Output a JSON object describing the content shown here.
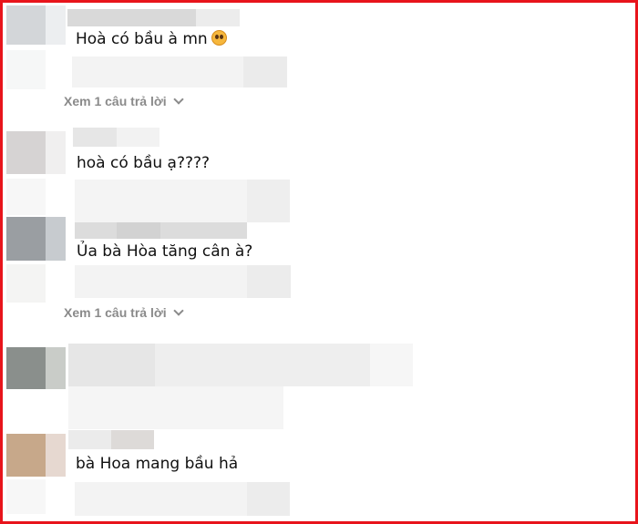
{
  "comments": [
    {
      "text": "Hoà có bầu à mn",
      "emoji": "pleading-face-emoji"
    },
    {
      "text": "hoà có bầu ạ????"
    },
    {
      "text": "Ủa bà Hòa tăng cân à?"
    },
    {
      "text": "bà Hoa mang bầu hả"
    }
  ],
  "replies": [
    {
      "label": "Xem 1 câu trả lời",
      "icon": "chevron-down-icon"
    },
    {
      "label": "Xem 1 câu trả lời",
      "icon": "chevron-down-icon"
    }
  ],
  "colors": {
    "frame": "#e8141b",
    "reply_link": "#8a8a8a",
    "text": "#111111"
  }
}
